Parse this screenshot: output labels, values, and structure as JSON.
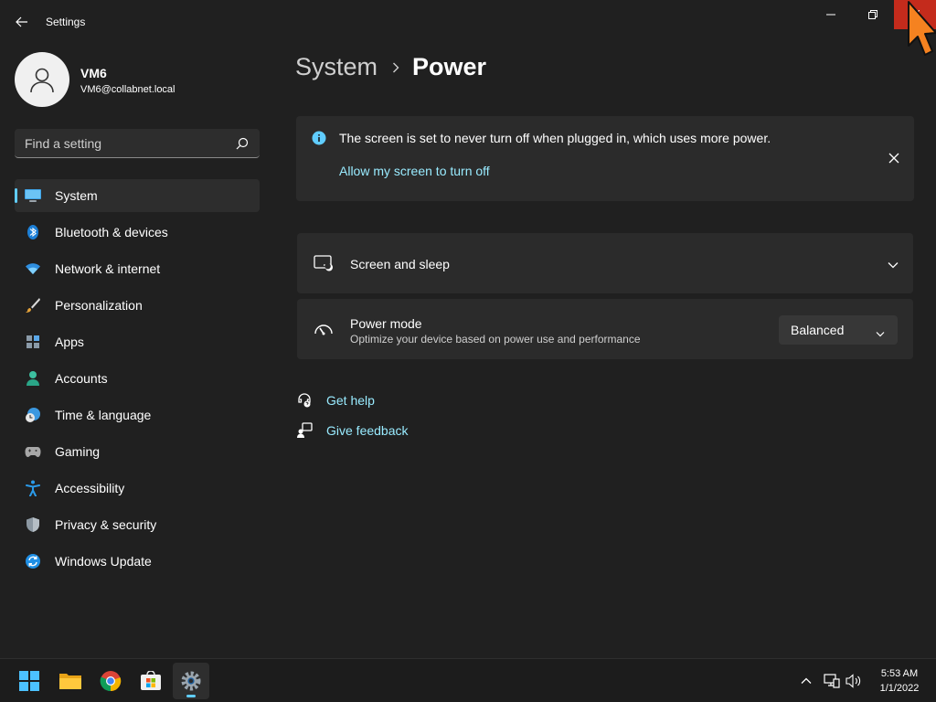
{
  "app": {
    "title": "Settings"
  },
  "profile": {
    "name": "VM6",
    "email": "VM6@collabnet.local"
  },
  "search": {
    "placeholder": "Find a setting"
  },
  "sidebar": {
    "items": [
      {
        "label": "System",
        "icon": "system-display-icon",
        "active": true
      },
      {
        "label": "Bluetooth & devices",
        "icon": "bluetooth-icon"
      },
      {
        "label": "Network & internet",
        "icon": "wifi-icon"
      },
      {
        "label": "Personalization",
        "icon": "brush-icon"
      },
      {
        "label": "Apps",
        "icon": "apps-icon"
      },
      {
        "label": "Accounts",
        "icon": "accounts-icon"
      },
      {
        "label": "Time & language",
        "icon": "time-language-icon"
      },
      {
        "label": "Gaming",
        "icon": "gamepad-icon"
      },
      {
        "label": "Accessibility",
        "icon": "accessibility-icon"
      },
      {
        "label": "Privacy & security",
        "icon": "shield-icon"
      },
      {
        "label": "Windows Update",
        "icon": "update-icon"
      }
    ]
  },
  "breadcrumb": {
    "parent": "System",
    "current": "Power"
  },
  "infobar": {
    "message": "The screen is set to never turn off when plugged in, which uses more power.",
    "link": "Allow my screen to turn off"
  },
  "cards": {
    "screen_sleep": {
      "title": "Screen and sleep"
    },
    "power_mode": {
      "title": "Power mode",
      "subtitle": "Optimize your device based on power use and performance",
      "value": "Balanced"
    }
  },
  "help": {
    "get_help": "Get help",
    "give_feedback": "Give feedback"
  },
  "taskbar": {
    "apps": [
      "start-icon",
      "file-explorer-icon",
      "chrome-icon",
      "store-icon",
      "settings-icon"
    ],
    "clock": {
      "time": "5:53 AM",
      "date": "1/1/2022"
    }
  },
  "colors": {
    "accent": "#60cdff",
    "link": "#99ebff",
    "close": "#c42b1c",
    "background": "#202020",
    "card": "#2b2b2b"
  }
}
